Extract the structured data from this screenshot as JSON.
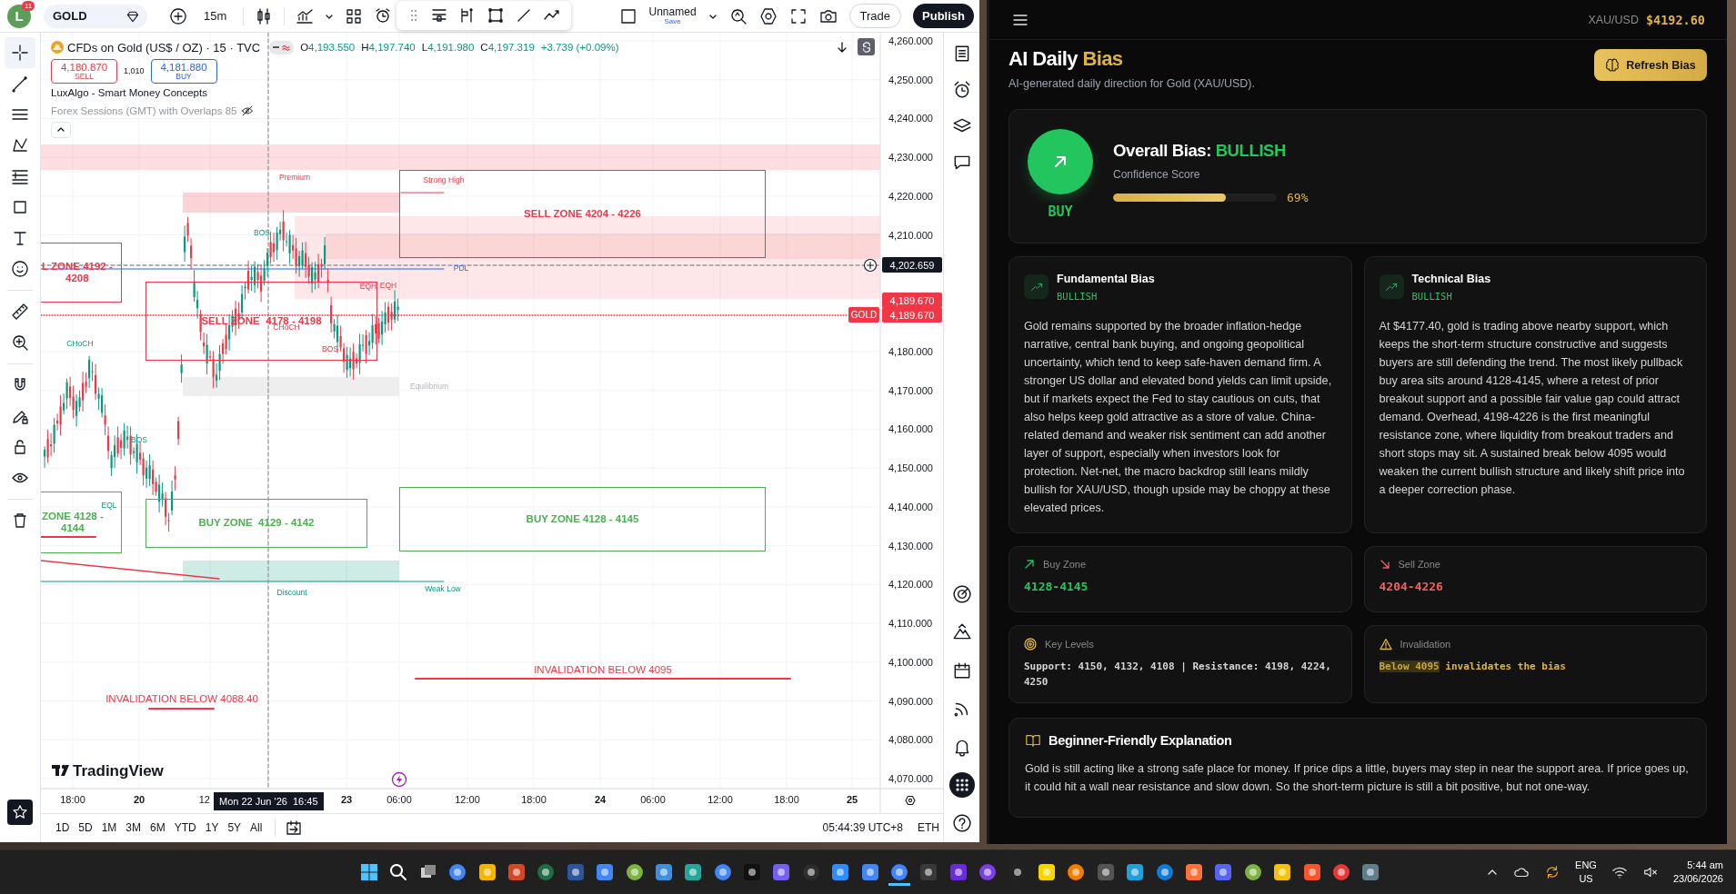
{
  "toolbar": {
    "avatar": "L",
    "notifications": "11",
    "symbol": "GOLD",
    "interval": "15m",
    "layout_name": "Unnamed",
    "save_label": "Save",
    "trade_button": "Trade",
    "publish_button": "Publish"
  },
  "legend": {
    "title": "CFDs on Gold (US$ / OZ) · 15 · TVC",
    "ohlc": [
      {
        "key": "O",
        "value": "4,193.550"
      },
      {
        "key": "H",
        "value": "4,197.740"
      },
      {
        "key": "L",
        "value": "4,191.980"
      },
      {
        "key": "C",
        "value": "4,197.319"
      }
    ],
    "change": "+3.739 (+0.09%)",
    "sell": {
      "price": "4,180.870",
      "label": "SELL"
    },
    "spread": "1,010",
    "buy": {
      "price": "4,181.880",
      "label": "BUY"
    },
    "indicators": [
      {
        "name": "LuxAlgo - Smart Money Concepts",
        "hidden": false
      },
      {
        "name": "Forex Sessions (GMT) with Overlaps 85",
        "hidden": true
      }
    ]
  },
  "chart": {
    "zones": [
      {
        "kind": "sell",
        "lines": [
          "SELL ZONE 4204 - 4226"
        ]
      },
      {
        "kind": "sell",
        "lines": [
          "L ZONE 4192 -",
          "4208"
        ]
      },
      {
        "kind": "sell",
        "lines": [
          "SELL ZONE  4178 - 4198"
        ]
      },
      {
        "kind": "buy",
        "lines": [
          "ZONE 4128 -",
          "4144"
        ]
      },
      {
        "kind": "buy",
        "lines": [
          "BUY ZONE  4129 - 4142"
        ]
      },
      {
        "kind": "buy",
        "lines": [
          "BUY ZONE 4128 - 4145"
        ]
      }
    ],
    "markers": [
      {
        "text": "Premium",
        "kind": "bearish"
      },
      {
        "text": "Strong High",
        "kind": "bearish"
      },
      {
        "text": "PDL",
        "kind": "level"
      },
      {
        "text": "EQH",
        "kind": "bearish"
      },
      {
        "text": "EQH",
        "kind": "bearish"
      },
      {
        "text": "CHoCH",
        "kind": "bearish"
      },
      {
        "text": "BOS",
        "kind": "bearish"
      },
      {
        "text": "BOS",
        "kind": "bullish"
      },
      {
        "text": "BOS",
        "kind": "bullish"
      },
      {
        "text": "CHoCH",
        "kind": "bullish"
      },
      {
        "text": "EQL",
        "kind": "bullish"
      },
      {
        "text": "Equilibrium",
        "kind": "neutral"
      },
      {
        "text": "Discount",
        "kind": "bullish"
      },
      {
        "text": "Weak Low",
        "kind": "bullish"
      }
    ],
    "invalidations": [
      "INVALIDATION BELOW 4095",
      "INVALIDATION BELOW 4088.40"
    ],
    "price_axis": [
      "4,260.000",
      "4,250.000",
      "4,240.000",
      "4,230.000",
      "4,220.000",
      "4,210.000",
      "4,180.000",
      "4,170.000",
      "4,160.000",
      "4,150.000",
      "4,140.000",
      "4,130.000",
      "4,120.000",
      "4,110.000",
      "4,100.000",
      "4,090.000",
      "4,080.000",
      "4,070.000"
    ],
    "price_tags": [
      {
        "kind": "crosshair",
        "text": "4,202.659"
      },
      {
        "kind": "high",
        "text": "4,189.670"
      },
      {
        "kind": "symbol",
        "label": "GOLD",
        "text": "4,189.670"
      }
    ],
    "time_axis": [
      {
        "text": "18:00",
        "kind": "time"
      },
      {
        "text": "20",
        "kind": "day"
      },
      {
        "text": "12",
        "kind": "time"
      },
      {
        "text": "23",
        "kind": "day"
      },
      {
        "text": "06:00",
        "kind": "time"
      },
      {
        "text": "12:00",
        "kind": "time"
      },
      {
        "text": "18:00",
        "kind": "time"
      },
      {
        "text": "24",
        "kind": "day"
      },
      {
        "text": "06:00",
        "kind": "time"
      },
      {
        "text": "12:00",
        "kind": "time"
      },
      {
        "text": "18:00",
        "kind": "time"
      },
      {
        "text": "25",
        "kind": "day"
      }
    ],
    "crosshair_date": "Mon 22 Jun '26  16:45",
    "logo_text": "TradingView"
  },
  "bottom_bar": {
    "ranges": [
      "1D",
      "5D",
      "1M",
      "3M",
      "6M",
      "YTD",
      "1Y",
      "5Y",
      "All"
    ],
    "clock": "05:44:39 UTC+8",
    "session": "ETH"
  },
  "bias_panel": {
    "pair": "XAU/USD",
    "price": "$4192.60",
    "title": "AI Daily",
    "title_accent": "Bias",
    "subtitle": "AI-generated daily direction for Gold (XAU/USD).",
    "refresh_button": "Refresh Bias",
    "overall": {
      "signal": "BUY",
      "label": "Overall Bias:",
      "value": "BULLISH",
      "confidence_label": "Confidence Score",
      "level": 0.69,
      "reading": "69%"
    },
    "analyses": [
      {
        "title": "Fundamental Bias",
        "bias": "BULLISH",
        "text": "Gold remains supported by the broader inflation-hedge narrative, central bank buying, and ongoing geopolitical uncertainty, which tend to keep safe-haven demand firm. A stronger US dollar and elevated bond yields can limit upside, but if markets expect the Fed to stay cautious on cuts, that also helps keep gold attractive as a store of value. China-related demand and weaker risk sentiment can add another layer of support, especially when investors look for protection. Net-net, the macro backdrop still leans mildly bullish for XAU/USD, though upside may be choppy at these elevated prices."
      },
      {
        "title": "Technical Bias",
        "bias": "BULLISH",
        "text": "At $4177.40, gold is trading above nearby support, which keeps the short-term structure constructive and suggests buyers are still defending the trend. The most likely pullback buy area sits around 4128-4145, where a retest of prior breakout support and a possible fair value gap could attract demand. Overhead, 4198-4226 is the first meaningful resistance zone, where liquidity from breakout traders and short stops may sit. A sustained break below 4095 would weaken the current bullish structure and likely shift price into a deeper correction phase."
      }
    ],
    "zones": [
      {
        "kind": "buy",
        "label": "Buy Zone",
        "value": "4128-4145"
      },
      {
        "kind": "sell",
        "label": "Sell Zone",
        "value": "4204-4226"
      }
    ],
    "key_levels": {
      "label": "Key Levels",
      "text": "Support: 4150, 4132, 4108 | Resistance: 4198, 4224, 4250"
    },
    "invalidation": {
      "label": "Invalidation",
      "highlight": "Below 4095",
      "text": "invalidates the bias"
    },
    "explanation": {
      "title": "Beginner-Friendly Explanation",
      "text": "Gold is still acting like a strong safe place for money. If price dips a little, buyers may step in near the support area. If price goes up, it could hit a wall near resistance and slow down. So the short-term picture is still a bit positive, but not one-way."
    }
  },
  "taskbar": {
    "language": "ENG",
    "region": "US",
    "time": "5:44 am",
    "date": "23/06/2026"
  }
}
